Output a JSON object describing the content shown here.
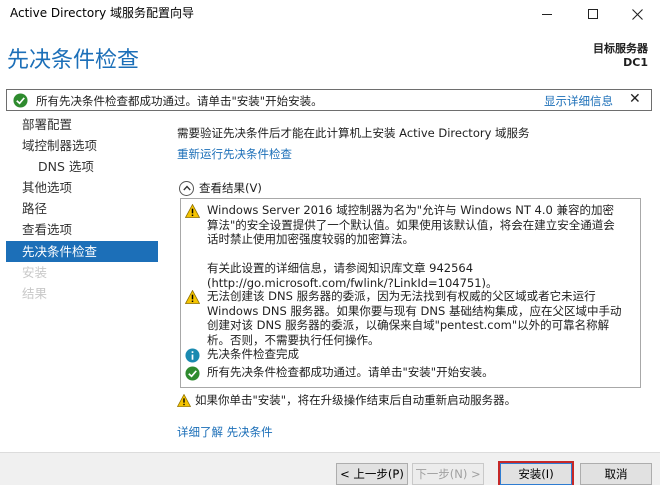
{
  "window": {
    "title": "Active Directory 域服务配置向导"
  },
  "header": {
    "page_title": "先决条件检查",
    "target_server_label": "目标服务器",
    "target_server_name": "DC1"
  },
  "banner": {
    "message": "所有先决条件检查都成功通过。请单击\"安装\"开始安装。",
    "details_link": "显示详细信息",
    "close_glyph": "✕"
  },
  "sidebar": {
    "items": [
      {
        "label": "部署配置",
        "state": "normal"
      },
      {
        "label": "域控制器选项",
        "state": "normal"
      },
      {
        "label": "DNS 选项",
        "state": "normal"
      },
      {
        "label": "其他选项",
        "state": "normal"
      },
      {
        "label": "路径",
        "state": "normal"
      },
      {
        "label": "查看选项",
        "state": "normal"
      },
      {
        "label": "先决条件检查",
        "state": "active"
      },
      {
        "label": "安装",
        "state": "disabled"
      },
      {
        "label": "结果",
        "state": "disabled"
      }
    ]
  },
  "main": {
    "description": "需要验证先决条件后才能在此计算机上安装 Active Directory 域服务",
    "rerun_link": "重新运行先决条件检查",
    "results_toggle_label": "查看结果(V)",
    "results": [
      {
        "icon": "warning-icon",
        "text": "Windows Server 2016 域控制器为名为\"允许与 Windows NT 4.0 兼容的加密算法\"的安全设置提供了一个默认值。如果使用该默认值，将会在建立安全通道会话时禁止使用加密强度较弱的加密算法。\n\n有关此设置的详细信息，请参阅知识库文章 942564 (http://go.microsoft.com/fwlink/?LinkId=104751)。"
      },
      {
        "icon": "warning-icon",
        "text": "无法创建该 DNS 服务器的委派，因为无法找到有权威的父区域或者它未运行 Windows DNS 服务器。如果你要与现有 DNS 基础结构集成，应在父区域中手动创建对该 DNS 服务器的委派，以确保来自域\"pentest.com\"以外的可靠名称解析。否则，不需要执行任何操作。"
      },
      {
        "icon": "info-icon",
        "text": "先决条件检查完成"
      },
      {
        "icon": "success-icon",
        "text": "所有先决条件检查都成功通过。请单击\"安装\"开始安装。"
      }
    ],
    "reboot_warning": "如果你单击\"安装\"，将在升级操作结束后自动重新启动服务器。",
    "learn_more_link": "详细了解 先决条件"
  },
  "footer": {
    "prev_label": "< 上一步(P)",
    "next_label": "下一步(N) >",
    "install_label": "安装(I)",
    "cancel_label": "取消"
  },
  "colors": {
    "accent": "#1c6fb8",
    "success": "#2e8b2e",
    "warning": "#f5c400",
    "info": "#1a8ab0",
    "highlight_box": "#c62828"
  }
}
